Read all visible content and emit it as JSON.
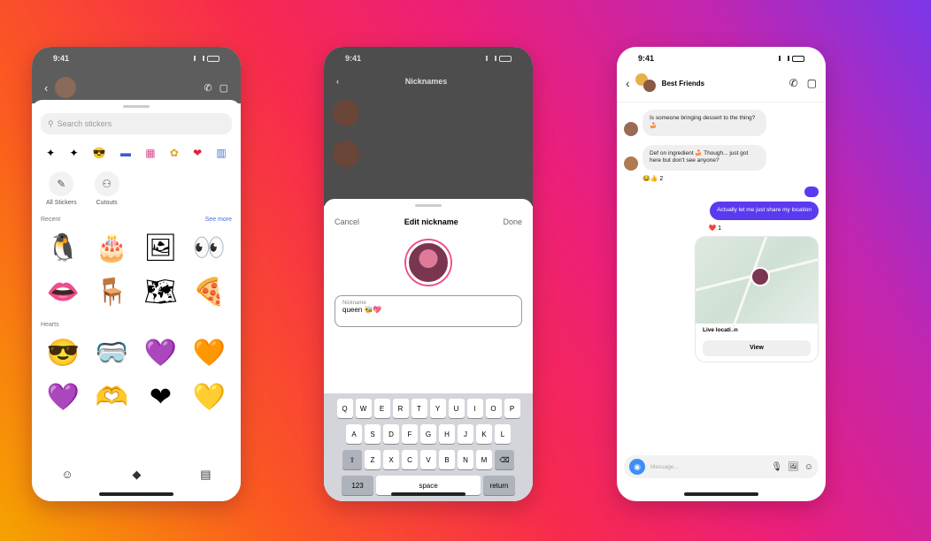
{
  "phone1": {
    "status_time": "9:41",
    "contact_name": "",
    "search_placeholder": "Search stickers",
    "categories": [
      "✦",
      "✦",
      "😎",
      "▬",
      "▦",
      "✿",
      "❤",
      "▥"
    ],
    "features": [
      {
        "label": "All Stickers",
        "icon": "✎"
      },
      {
        "label": "Cutouts",
        "icon": "⚇"
      }
    ],
    "recent_label": "Recent",
    "see_more_label": "See more",
    "recent_stickers": [
      "🐧",
      "🎂",
      "🖼",
      "👀",
      "👄",
      "🪑",
      "🗺",
      "🍕"
    ],
    "hearts_label": "Hearts",
    "heart_stickers": [
      "😎",
      "🥽",
      "💜",
      "🧡",
      "💜",
      "🫶",
      "❤",
      "💛"
    ],
    "tabs": [
      "☺",
      "◆",
      "▤"
    ]
  },
  "phone2": {
    "status_time": "9:41",
    "header_title": "Nicknames",
    "header_sub": "",
    "members": [
      {
        "name": "",
        "sub": ""
      },
      {
        "name": "",
        "sub": ""
      }
    ],
    "sheet_cancel": "Cancel",
    "sheet_title": "Edit nickname",
    "sheet_done": "Done",
    "input_label": "Nickname",
    "input_value": "queen 🐝💖",
    "input_count": "",
    "hint": "",
    "keyboard_rows": [
      [
        "Q",
        "W",
        "E",
        "R",
        "T",
        "Y",
        "U",
        "I",
        "O",
        "P"
      ],
      [
        "A",
        "S",
        "D",
        "F",
        "G",
        "H",
        "J",
        "K",
        "L"
      ],
      [
        "Z",
        "X",
        "C",
        "V",
        "B",
        "N",
        "M"
      ]
    ],
    "key_shift": "⇧",
    "key_delete": "⌫",
    "key_123": "123",
    "key_space": "space",
    "key_return": "return",
    "key_emoji": "☺",
    "key_mic": "🎙"
  },
  "phone3": {
    "status_time": "9:41",
    "chat_title": "Best Friends",
    "chat_sub": "",
    "messages": {
      "m1": "Is someone bringing dessert to the thing? 🍰",
      "sender2": "",
      "m2": "Def on ingredient 🍰 Though... just got here but don't see anyone?",
      "react2": "😂👍 2",
      "m3": "",
      "m4": "Actually let me just share my location",
      "react4": "❤️ 1"
    },
    "location_title": "Live location",
    "location_sub": "",
    "view_label": "View",
    "composer_placeholder": "Message...",
    "composer_icons": [
      "🎙",
      "🖼",
      "☺"
    ]
  }
}
